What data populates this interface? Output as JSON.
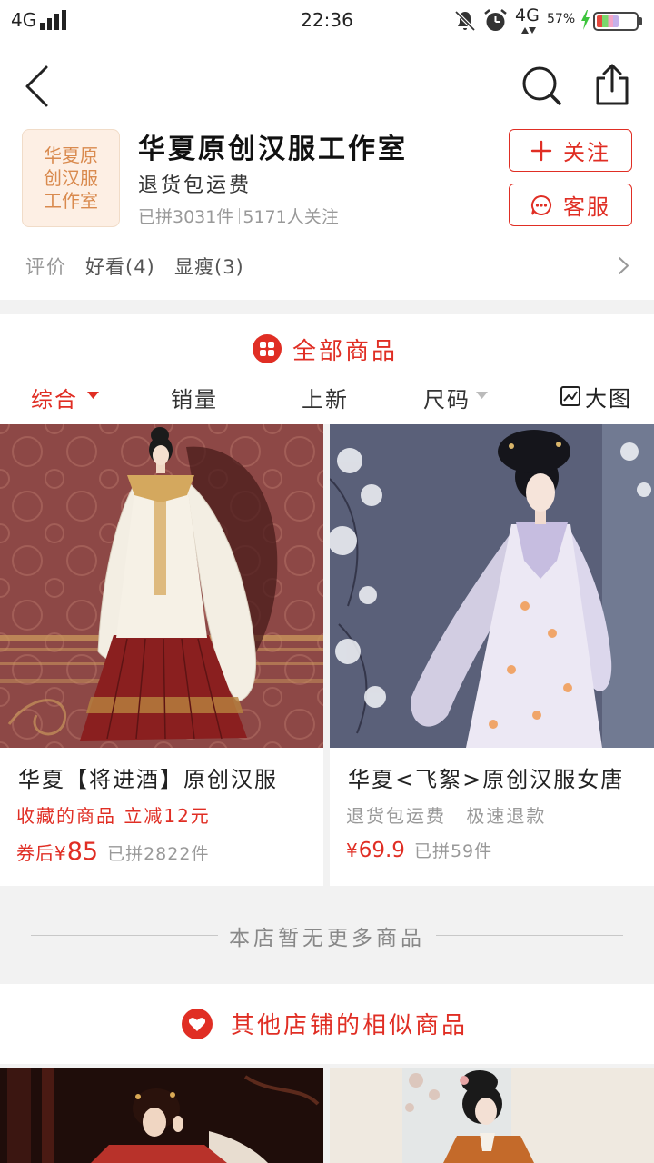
{
  "status_bar": {
    "network_left": "4G",
    "signal_bars": 4,
    "time": "22:36",
    "network_right": "4G",
    "battery_percent": "57%",
    "battery_level": 0.57,
    "charging": true
  },
  "nav": {
    "back_icon": "chevron-left-icon",
    "search_icon": "search-icon",
    "share_icon": "share-icon"
  },
  "store": {
    "logo_lines": [
      "华夏原",
      "创汉服",
      "工作室"
    ],
    "name": "华夏原创汉服工作室",
    "tag": "退货包运费",
    "sold": "已拼3031件",
    "followers": "5171人关注",
    "follow_label": "关注",
    "service_label": "客服"
  },
  "reviews": {
    "label": "评价",
    "tags": [
      "好看(4)",
      "显瘦(3)"
    ]
  },
  "all_products": {
    "title": "全部商品",
    "icon": "grid-icon"
  },
  "sort_bar": {
    "items": [
      {
        "label": "综合",
        "active": true,
        "has_caret": true
      },
      {
        "label": "销量",
        "active": false,
        "has_caret": false
      },
      {
        "label": "上新",
        "active": false,
        "has_caret": false
      },
      {
        "label": "尺码",
        "active": false,
        "has_caret": true
      }
    ],
    "view_toggle_label": "大图"
  },
  "products": [
    {
      "title": "华夏【将进酒】原创汉服",
      "promo": "收藏的商品 立减12元",
      "price_prefix": "券后¥",
      "price": "85",
      "sold": "已拼2822件"
    },
    {
      "title": "华夏<飞絮>原创汉服女唐",
      "tags": [
        "退货包运费",
        "极速退款"
      ],
      "price_prefix": "¥",
      "price": "69.9",
      "sold": "已拼59件"
    }
  ],
  "end_notice": "本店暂无更多商品",
  "similar": {
    "title": "其他店铺的相似商品",
    "icon": "heart-icon"
  },
  "colors": {
    "accent": "#e02e24",
    "text": "#222222",
    "muted": "#999999",
    "logo_bg": "#fdefe4",
    "logo_text": "#d98a4e",
    "page_bg": "#f2f2f2",
    "charging": "#3cc43c"
  }
}
